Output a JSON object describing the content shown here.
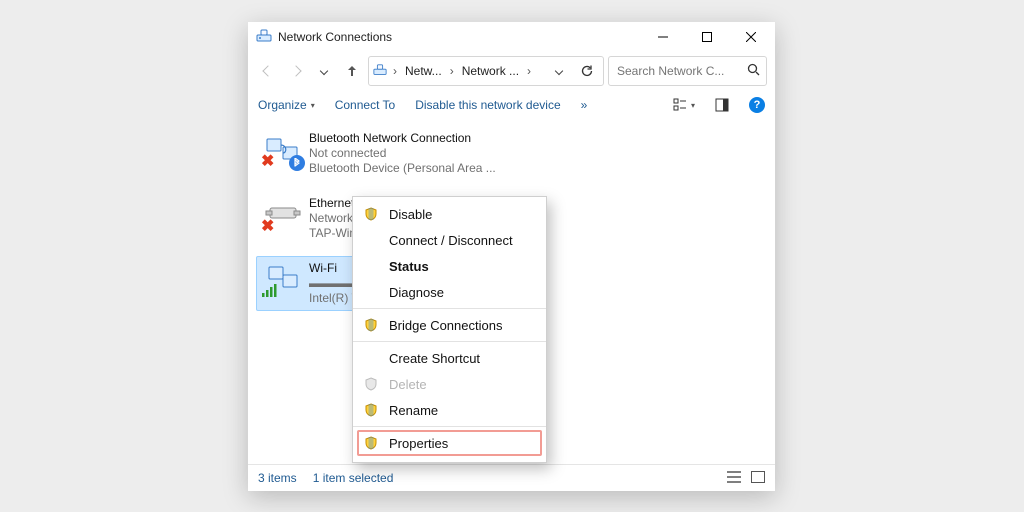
{
  "window": {
    "title": "Network Connections"
  },
  "nav": {
    "breadcrumbs": [
      "Netw...",
      "Network ..."
    ],
    "search_placeholder": "Search Network C..."
  },
  "toolbar": {
    "organize": "Organize",
    "connect_to": "Connect To",
    "disable": "Disable this network device",
    "more": "»"
  },
  "connections": [
    {
      "name": "Bluetooth Network Connection",
      "status": "Not connected",
      "device": "Bluetooth Device (Personal Area ...",
      "error": true,
      "bluetooth": true,
      "selected": false
    },
    {
      "name": "Ethernet 2",
      "status": "Network cable unplugged",
      "device": "TAP-Windows Adapter V9",
      "error": true,
      "bluetooth": false,
      "selected": false
    },
    {
      "name": "Wi-Fi",
      "status": "",
      "device": "Intel(R) W",
      "error": false,
      "bluetooth": false,
      "selected": true,
      "wifi": true
    }
  ],
  "context_menu": {
    "disable": "Disable",
    "connect": "Connect / Disconnect",
    "status": "Status",
    "diagnose": "Diagnose",
    "bridge": "Bridge Connections",
    "shortcut": "Create Shortcut",
    "delete": "Delete",
    "rename": "Rename",
    "properties": "Properties"
  },
  "statusbar": {
    "count": "3 items",
    "selected": "1 item selected"
  }
}
